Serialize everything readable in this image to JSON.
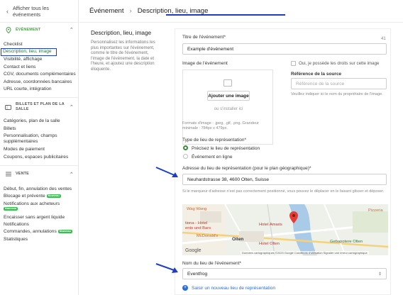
{
  "sidebar": {
    "back_label": "Afficher tous les événements",
    "sections": [
      {
        "title": "ÉVÉNEMENT",
        "items": [
          "Checklist",
          "Description, lieu, image",
          "Visibilité, affichage",
          "Contact et liens",
          "CGV, documents complémentaires",
          "Adresse, coordonnées bancaires",
          "URL courte, intégration"
        ]
      },
      {
        "title": "BILLETS ET PLAN DE LA SALLE",
        "items": [
          "Catégories, plan de la salle",
          "Billets",
          "Personnalisation, champs supplémentaires",
          "Modes de paiement",
          "Coupons, espaces publicitaires"
        ]
      },
      {
        "title": "VENTE",
        "items": [
          "Début, fin, annulation des ventes",
          "Blocage et prévente",
          "Notifications aux acheteurs",
          "Encaisser sans argent liquide",
          "Notifications",
          "Commandes, annulations",
          "Statistiques"
        ]
      }
    ],
    "badges": {
      "blocage": "Nouveau",
      "notifications_acheteurs": "Nouveau",
      "commandes": "Nouveau"
    }
  },
  "breadcrumb": {
    "root": "Événement",
    "current": "Description, lieu, image"
  },
  "description": {
    "title": "Description, lieu, image",
    "text": "Personnalisez les informations les plus importantes sur l'événement, comme le titre de l'événement, l'image de l'événement, la date et l'heure, et ajoutez une description éloquente."
  },
  "form": {
    "title_label": "Titre de l'événement*",
    "title_count": "41",
    "title_value": "Example d'événement",
    "image_label": "Image de l'événement",
    "add_image_button": "Ajouter une image",
    "drop_hint": "ou s'installer ici",
    "image_formats": "Formats d'image : .jpeg, .gif, .png. Grandeur minimale : 784px x 479px.",
    "rights_label": "Oui, je possède les droits sur cette image",
    "source_label": "Référence de la source",
    "source_placeholder": "Référence de la source",
    "source_hint": "Veuillez indiquer ici le nom du propriétaire de l'image.",
    "venue_type_label": "Type de lieu de représentation*",
    "venue_options": [
      "Précisez le lieu de représentation",
      "Événement en ligne"
    ],
    "address_label": "Adresse du lieu de représentation (pour le plan géographique)*",
    "address_value": "Neuhardstrasse 38, 4600 Olten, Suisse",
    "map_hint": "Si le marqueur d'adresse n'est pas correctement positionné, vous pouvez le déplacer en le faisant glisser et déposer.",
    "venue_name_label": "Nom du lieu de l'événement*",
    "venue_name_value": "Eventfrog",
    "new_venue_link": "Saisir un nouveau lieu de représentation"
  },
  "map": {
    "labels": [
      "Wag Wang",
      "Pizzeria",
      "tiona - Hotel",
      "ento und Bars",
      "Hotel Amaris",
      "McDonald's",
      "Olten",
      "Hotel Olten",
      "Gebapotere Olten"
    ],
    "attribution": "Données cartographiques ©2023 Google   Conditions d'utilisation   Signaler une erreur cartographique",
    "google": "Google"
  },
  "colors": {
    "accent_green": "#3a8b3a",
    "highlight_blue": "#1d3fbf",
    "link_blue": "#2a6fd6"
  }
}
